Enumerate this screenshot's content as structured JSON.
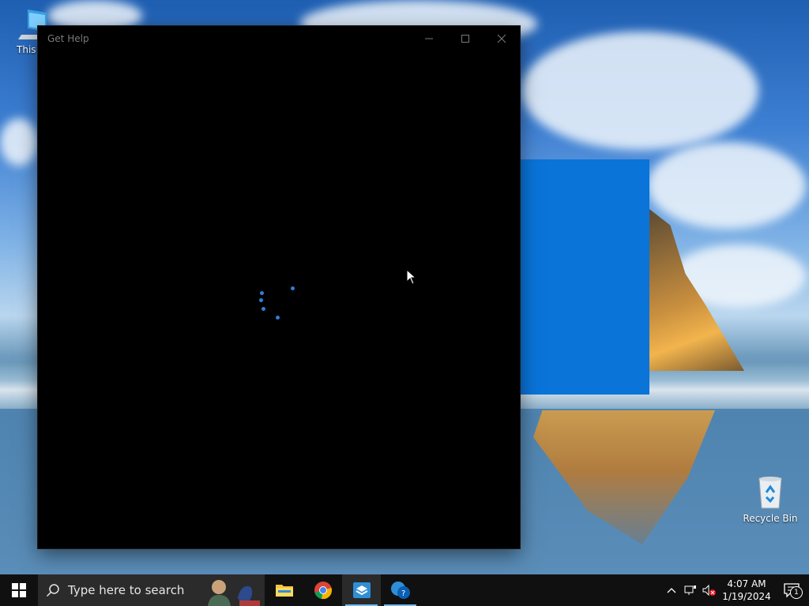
{
  "desktop": {
    "icons": [
      {
        "label": "This PC"
      },
      {
        "label": "Recycle Bin"
      }
    ]
  },
  "window": {
    "title": "Get Help",
    "controls": {
      "minimize": "minimize",
      "maximize": "maximize",
      "close": "close"
    },
    "state": "loading"
  },
  "taskbar": {
    "search_placeholder": "Type here to search",
    "apps": [
      {
        "name": "File Explorer",
        "icon": "folder-icon",
        "active": false
      },
      {
        "name": "Google Chrome",
        "icon": "chrome-icon",
        "active": false
      },
      {
        "name": "Windows Sandbox",
        "icon": "sandbox-icon",
        "active": true
      },
      {
        "name": "Get Help",
        "icon": "get-help-icon",
        "active": true
      }
    ],
    "clock": {
      "time": "4:07 AM",
      "date": "1/19/2024"
    },
    "notifications_count": "1"
  },
  "colors": {
    "accent": "#0a74d9",
    "spinner": "#2f7fd6",
    "taskbar": "#101010"
  }
}
